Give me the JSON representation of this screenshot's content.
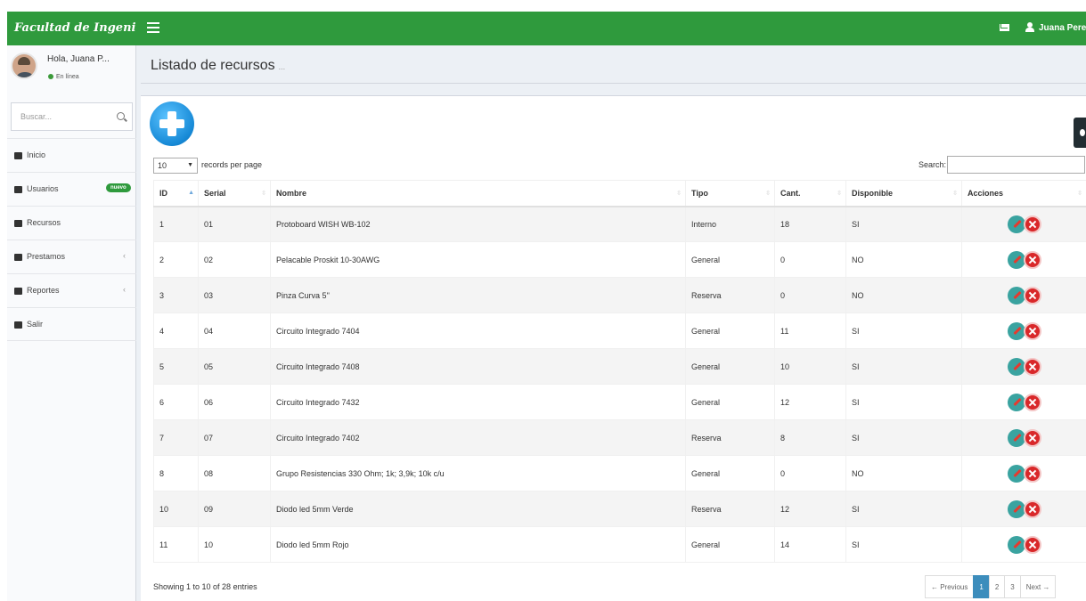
{
  "header": {
    "brand": "Facultad de Ingeniería",
    "user": "Juana Perez"
  },
  "sidebar": {
    "user_name": "Hola, Juana P...",
    "user_status": "En línea",
    "search_placeholder": "Buscar...",
    "items": [
      {
        "label": "Inicio",
        "icon": "dashboard-icon"
      },
      {
        "label": "Usuarios",
        "icon": "users-icon",
        "badge": "nuevo"
      },
      {
        "label": "Recursos",
        "icon": "book-icon"
      },
      {
        "label": "Prestamos",
        "icon": "plus-square-icon"
      },
      {
        "label": "Reportes",
        "icon": "bar-chart-icon"
      },
      {
        "label": "Salir",
        "icon": "logout-icon"
      }
    ]
  },
  "page": {
    "title": "Listado de recursos",
    "subtitle": "..."
  },
  "table_controls": {
    "page_size": "10",
    "page_size_label": "records per page",
    "search_label": "Search:"
  },
  "table": {
    "columns": [
      "ID",
      "Serial",
      "Nombre",
      "Tipo",
      "Cant.",
      "Disponible",
      "Acciones"
    ],
    "rows": [
      [
        "1",
        "01",
        "Protoboard WISH WB-102",
        "Interno",
        "18",
        "SI"
      ],
      [
        "2",
        "02",
        "Pelacable Proskit 10-30AWG",
        "General",
        "0",
        "NO"
      ],
      [
        "3",
        "03",
        "Pinza Curva 5''",
        "Reserva",
        "0",
        "NO"
      ],
      [
        "4",
        "04",
        "Circuito Integrado 7404",
        "General",
        "11",
        "SI"
      ],
      [
        "5",
        "05",
        "Circuito Integrado 7408",
        "General",
        "10",
        "SI"
      ],
      [
        "6",
        "06",
        "Circuito Integrado 7432",
        "General",
        "12",
        "SI"
      ],
      [
        "7",
        "07",
        "Circuito Integrado 7402",
        "Reserva",
        "8",
        "SI"
      ],
      [
        "8",
        "08",
        "Grupo Resistencias 330 Ohm; 1k; 3,9k; 10k c/u",
        "General",
        "0",
        "NO"
      ],
      [
        "10",
        "09",
        "Diodo led 5mm Verde",
        "Reserva",
        "12",
        "SI"
      ],
      [
        "11",
        "10",
        "Diodo led 5mm Rojo",
        "General",
        "14",
        "SI"
      ]
    ]
  },
  "footer": {
    "info": "Showing 1 to 10 of 28 entries",
    "pagination": [
      "← Previous",
      "1",
      "2",
      "3",
      "Next →"
    ],
    "active_page": "1"
  },
  "colors": {
    "header_green": "#2f9a3d",
    "active_page": "#3c8dbc"
  }
}
